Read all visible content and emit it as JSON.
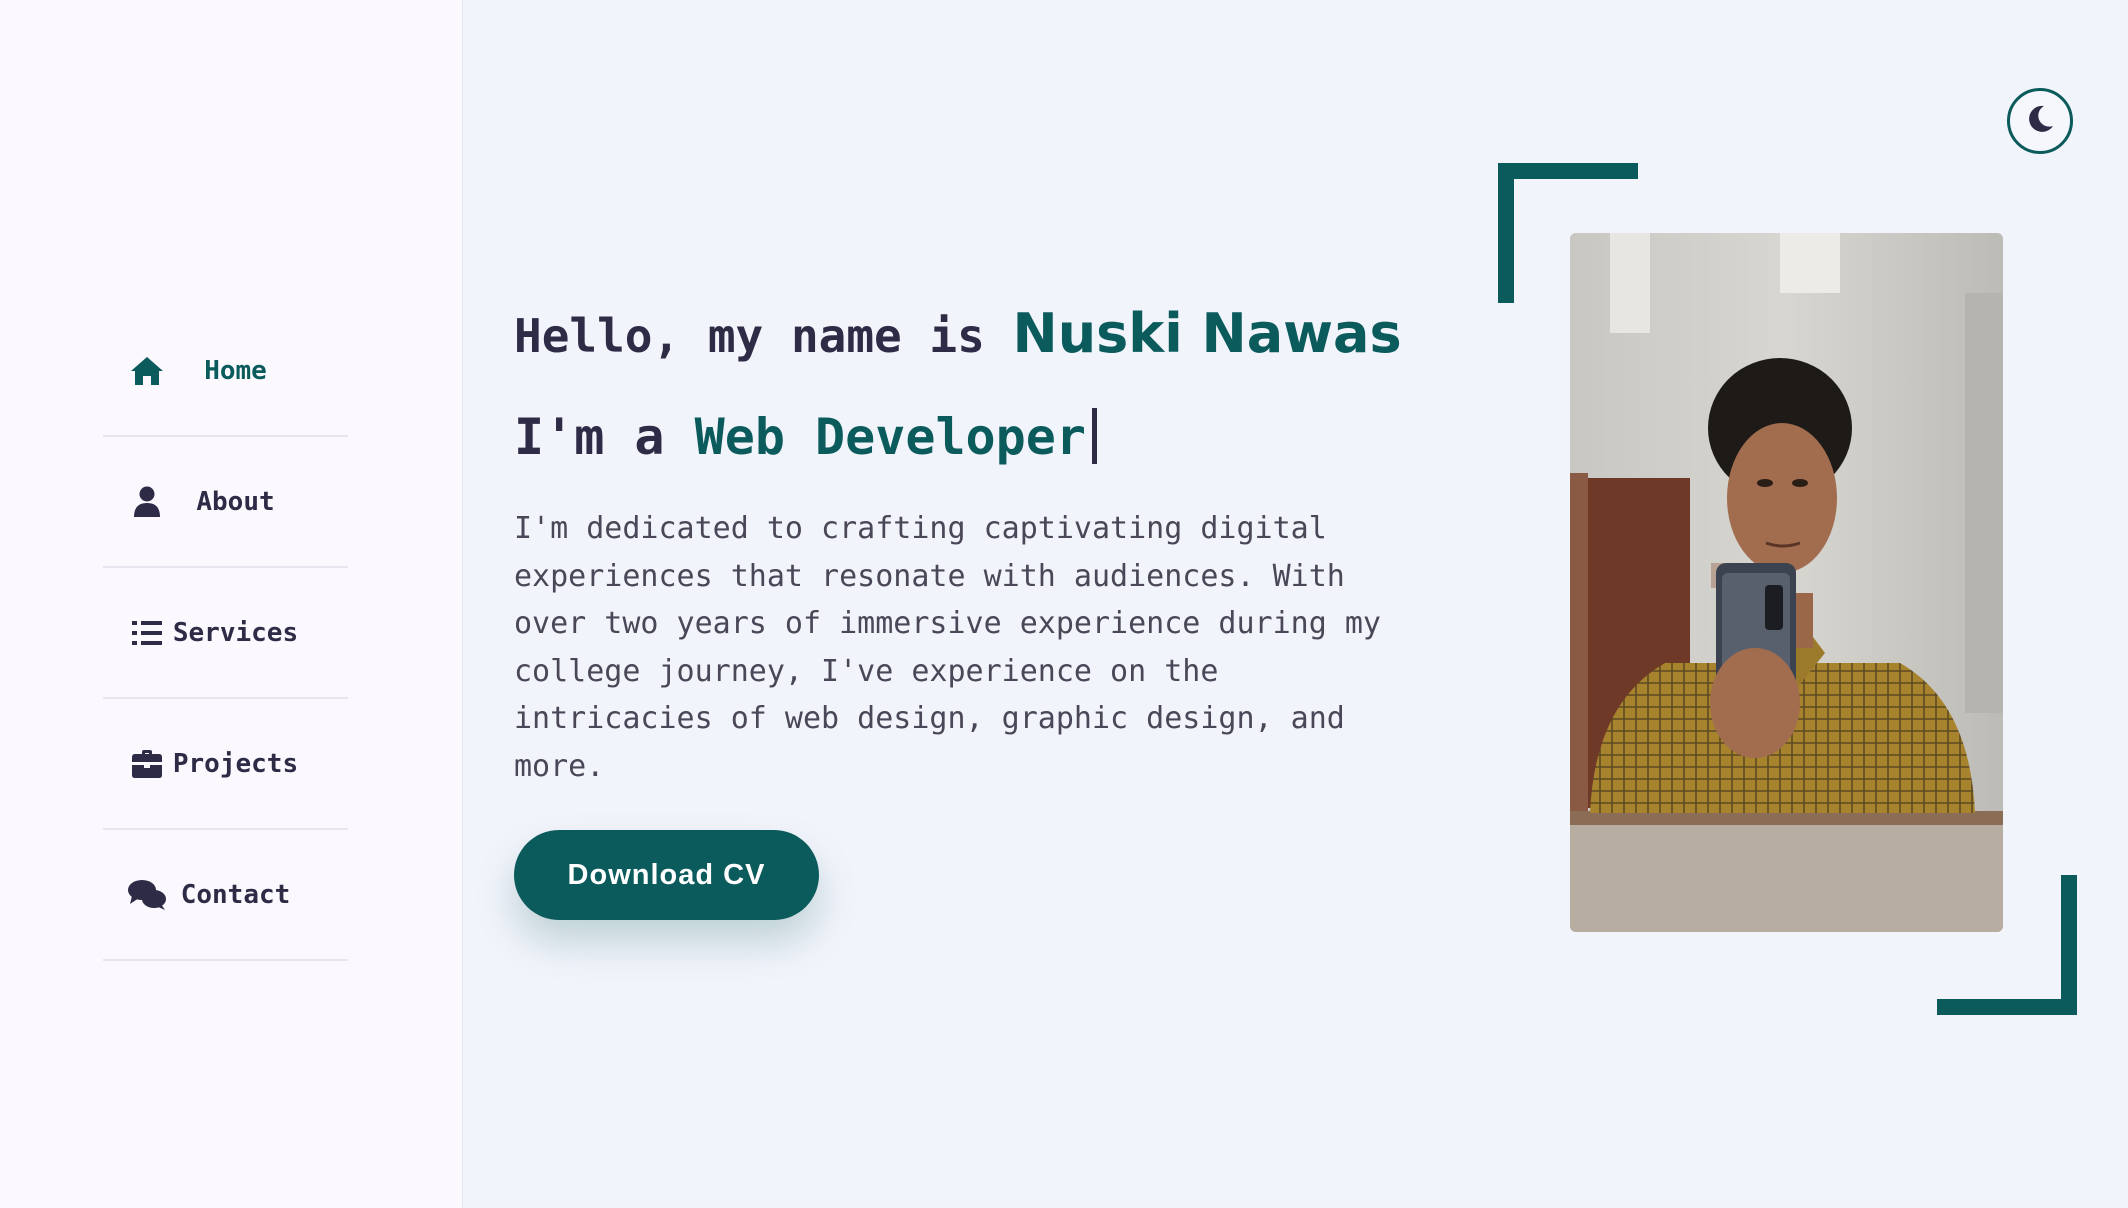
{
  "nav": {
    "items": [
      {
        "label": "Home",
        "icon": "home-icon",
        "active": true
      },
      {
        "label": "About",
        "icon": "user-icon",
        "active": false
      },
      {
        "label": "Services",
        "icon": "list-icon",
        "active": false
      },
      {
        "label": "Projects",
        "icon": "briefcase-icon",
        "active": false
      },
      {
        "label": "Contact",
        "icon": "chat-icon",
        "active": false
      }
    ]
  },
  "hero": {
    "greeting_prefix": "Hello, my name is ",
    "name": "Nuski Nawas",
    "role_prefix": "I'm a ",
    "role": "Web Developer",
    "description": "I'm dedicated to crafting captivating digital experiences that resonate with audiences. With over two years of immersive experience during my college journey, I've experience on the intricacies of web design, graphic design, and more.",
    "cta_label": "Download CV"
  },
  "theme_toggle": {
    "icon": "moon-icon"
  },
  "profile_photo": {
    "alt": "profile photo"
  },
  "colors": {
    "accent": "#0b5a5c",
    "text": "#2d2b45",
    "background": "#f2f4fb",
    "sidebar": "#fbf9fe"
  }
}
